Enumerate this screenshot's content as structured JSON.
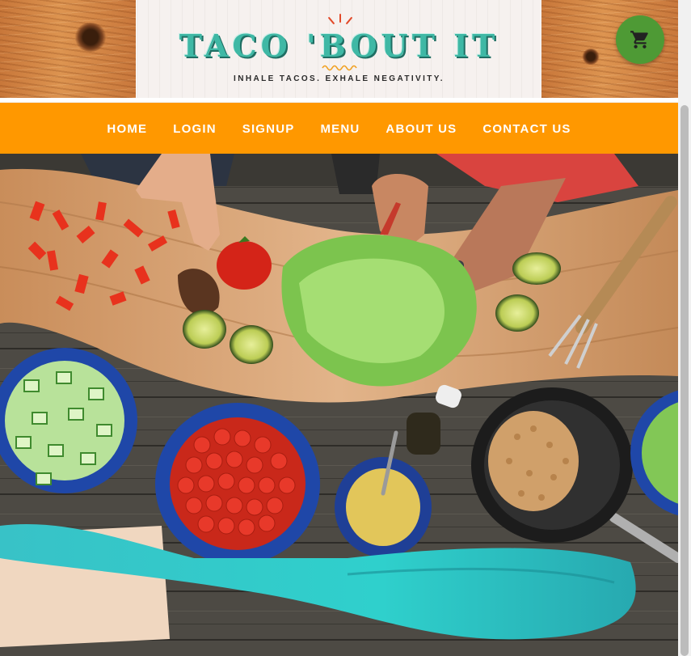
{
  "header": {
    "title": "TACO 'BOUT IT",
    "tagline": "INHALE TACOS. EXHALE NEGATIVITY.",
    "cart_icon": "shopping-cart-icon"
  },
  "nav": {
    "items": [
      {
        "label": "HOME"
      },
      {
        "label": "LOGIN"
      },
      {
        "label": "SIGNUP"
      },
      {
        "label": "MENU"
      },
      {
        "label": "ABOUT US"
      },
      {
        "label": "CONTACT US"
      }
    ]
  },
  "colors": {
    "nav_background": "#ff9800",
    "title_teal": "#3fb8a5",
    "accent_red": "#e24a2a",
    "cart_green": "#4e9a35"
  }
}
